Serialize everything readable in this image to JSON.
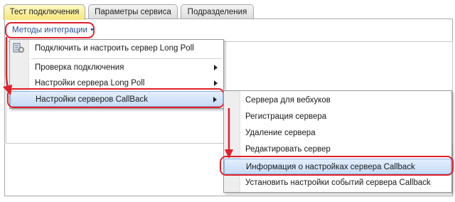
{
  "tabs": [
    {
      "label": "Тест подключения",
      "active": true
    },
    {
      "label": "Параметры сервиса",
      "active": false
    },
    {
      "label": "Подразделения",
      "active": false
    }
  ],
  "integration_button": {
    "label": "Методы интеграции"
  },
  "main_menu": {
    "items": [
      {
        "label": "Подключить и настроить сервер Long Poll",
        "icon": "server-settings-icon",
        "submenu": false
      },
      {
        "label": "Проверка подключения",
        "submenu": true
      },
      {
        "label": "Настройки сервера Long Poll",
        "submenu": true
      },
      {
        "label": "Настройки серверов CallBack",
        "submenu": true,
        "selected": true
      }
    ]
  },
  "callback_submenu": {
    "items": [
      {
        "label": "Сервера для вебхуков"
      },
      {
        "label": "Регистрация сервера"
      },
      {
        "label": "Удаление сервера"
      },
      {
        "label": "Редактировать сервер"
      },
      {
        "label": "Информация о настройках сервера Callback",
        "selected": true
      },
      {
        "label": "Установить настройки событий сервера Callback"
      }
    ]
  },
  "colors": {
    "highlight": "#e0202a",
    "active_tab": "#f7e67a",
    "selection": "#c6dcf7"
  }
}
